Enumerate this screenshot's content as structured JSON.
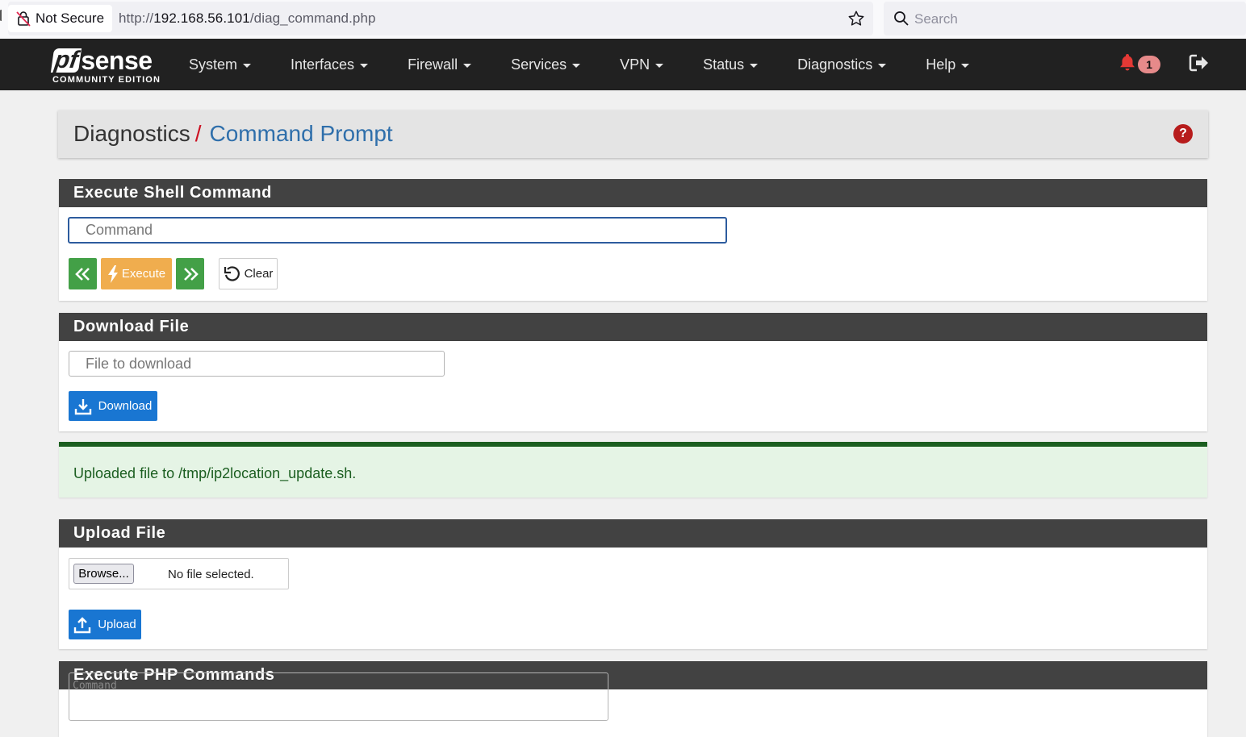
{
  "browser": {
    "security_label": "Not Secure",
    "url_scheme": "http://",
    "url_host": "192.168.56.101",
    "url_path": "/diag_command.php",
    "search_placeholder": "Search"
  },
  "navbar": {
    "logo_main": "sense",
    "logo_pf": "pf",
    "logo_sub": "COMMUNITY EDITION",
    "menu": [
      "System",
      "Interfaces",
      "Firewall",
      "Services",
      "VPN",
      "Status",
      "Diagnostics",
      "Help"
    ],
    "notification_count": "1"
  },
  "header": {
    "crumb_parent": "Diagnostics",
    "crumb_sep": "/",
    "crumb_current": "Command Prompt",
    "help_icon": "?"
  },
  "shell": {
    "title": "Execute Shell Command",
    "command_placeholder": "Command",
    "execute_label": "Execute",
    "clear_label": "Clear"
  },
  "download": {
    "title": "Download File",
    "placeholder": "File to download",
    "button_label": "Download"
  },
  "alert": {
    "message": "Uploaded file to /tmp/ip2location_update.sh."
  },
  "upload": {
    "title": "Upload File",
    "browse_label": "Browse...",
    "no_file_text": "No file selected.",
    "button_label": "Upload"
  },
  "php": {
    "title": "Execute PHP Commands",
    "placeholder": "Command"
  },
  "colors": {
    "navbar": "#212121",
    "panel_head": "#424242",
    "green": "#43a047",
    "orange": "#f0ad4e",
    "blue": "#1976d2",
    "alert_text": "#1b5e20",
    "help_red": "#b71c1c"
  }
}
